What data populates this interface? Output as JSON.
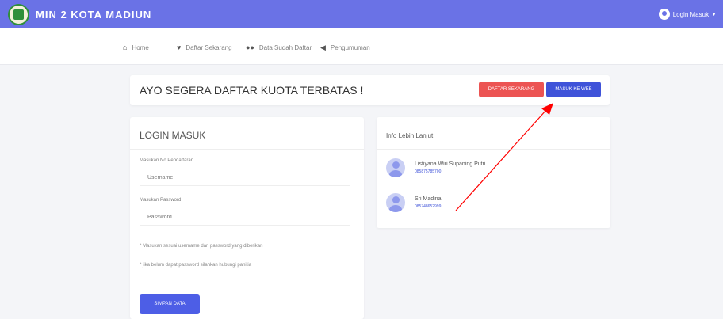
{
  "header": {
    "brand": "MIN 2 KOTA MADIUN",
    "user_menu": "Login Masuk"
  },
  "nav": {
    "items": [
      {
        "label": "Home",
        "icon": "home-icon"
      },
      {
        "label": "Daftar Sekarang",
        "icon": "heart-icon"
      },
      {
        "label": "Data Sudah Daftar",
        "icon": "users-icon"
      },
      {
        "label": "Pengumuman",
        "icon": "megaphone-icon"
      }
    ]
  },
  "banner": {
    "title": "AYO SEGERA DAFTAR KUOTA TERBATAS !",
    "register_button": "DAFTAR SEKARANG",
    "web_button": "MASUK KE WEB"
  },
  "login": {
    "title": "LOGIN MASUK",
    "username_label": "Masukan No Pendaftaran",
    "username_placeholder": "Username",
    "password_label": "Masukan Password",
    "password_placeholder": "Password",
    "note_1": "* Masukan sesuai username dan password yang diberikan",
    "note_2": "* jika belum dapat password silahkan hubungi panitia",
    "submit_button": "SIMPAN DATA"
  },
  "info": {
    "title": "Info Lebih Lanjut",
    "contacts": [
      {
        "name": "Listiyana Wiri Supaning Putri",
        "phone": "085875785700"
      },
      {
        "name": "Sri Madina",
        "phone": "085748652999"
      }
    ]
  },
  "colors": {
    "header": "#6a72e6",
    "danger": "#ec5453",
    "primary": "#3f53d9",
    "annotation_arrow": "#ff0000"
  }
}
